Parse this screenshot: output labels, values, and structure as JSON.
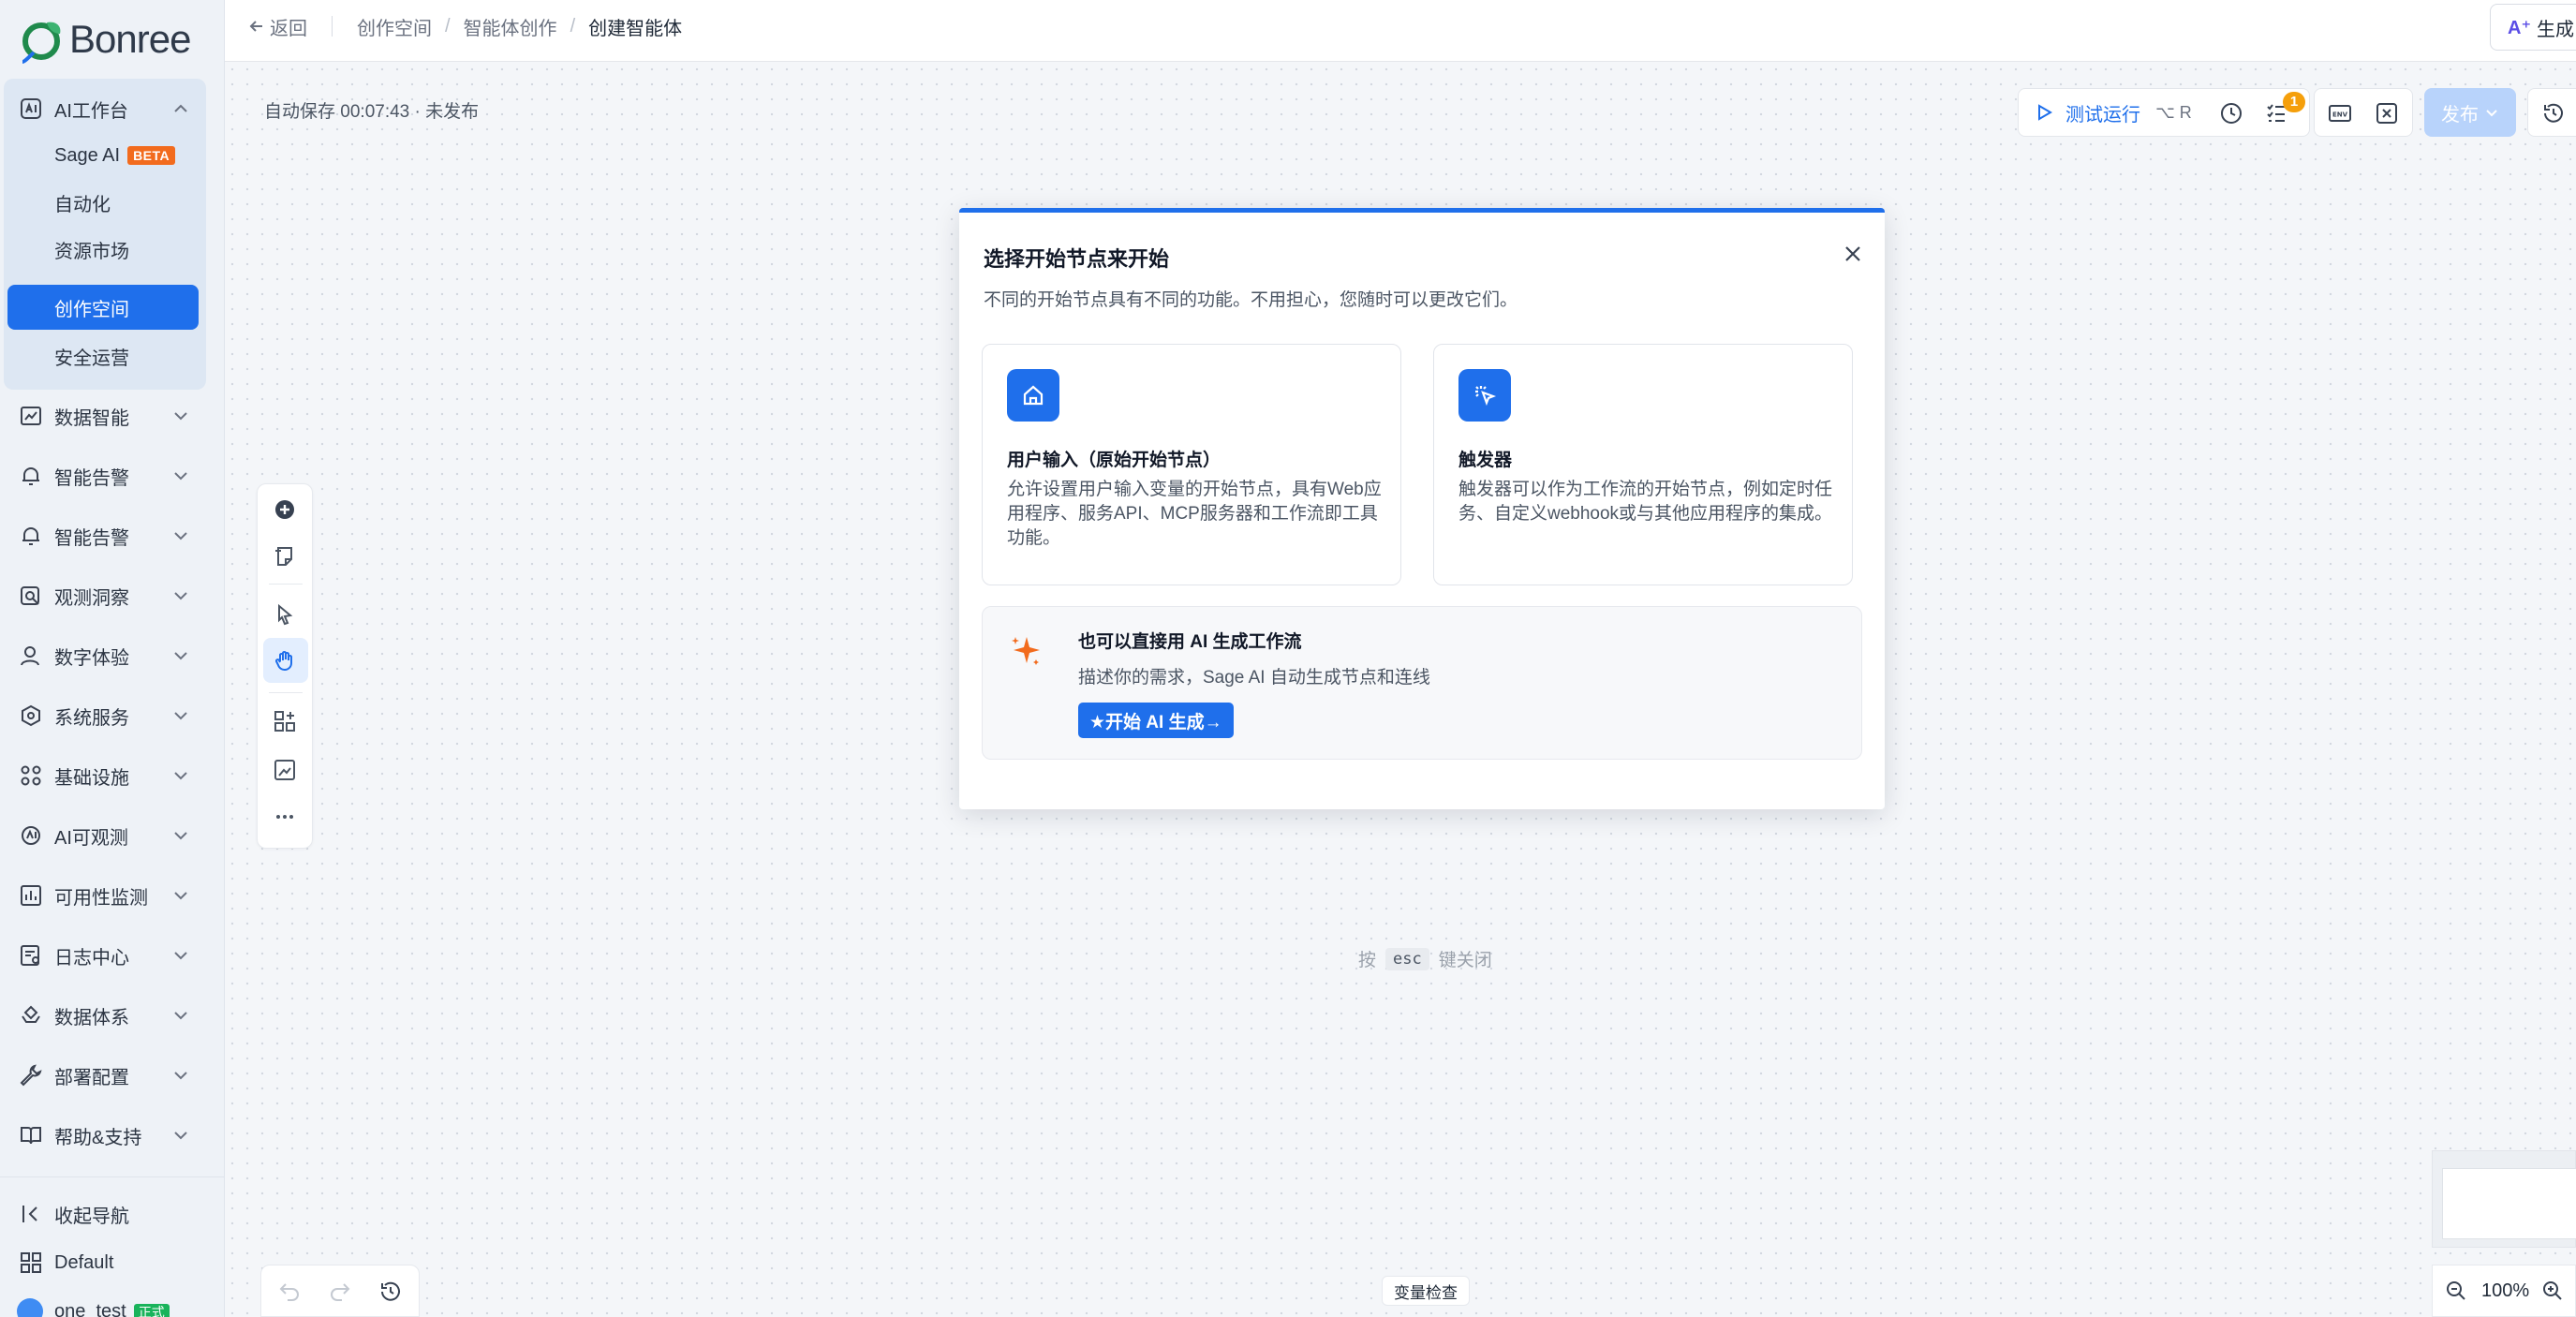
{
  "brand": {
    "name": "Bonree"
  },
  "colors": {
    "accent": "#1f6feb",
    "beta_badge": "#f26b1d",
    "env_badge": "#19b35b",
    "notif_badge": "#f59f0b",
    "ai_orange": "#f26b1d"
  },
  "sidebar": {
    "workbench": {
      "label": "AI工作台",
      "icon": "ai-workbench-icon",
      "children": [
        {
          "label": "Sage AI",
          "badge": "BETA"
        },
        {
          "label": "自动化"
        },
        {
          "label": "资源市场"
        },
        {
          "label": "创作空间",
          "active": true
        },
        {
          "label": "安全运营"
        }
      ]
    },
    "items": [
      {
        "label": "数据智能",
        "icon": "chart-icon"
      },
      {
        "label": "智能告警",
        "icon": "alert-icon"
      },
      {
        "label": "智能告警",
        "icon": "alert-icon"
      },
      {
        "label": "观测洞察",
        "icon": "search-icon"
      },
      {
        "label": "数字体验",
        "icon": "user-icon"
      },
      {
        "label": "系统服务",
        "icon": "service-icon"
      },
      {
        "label": "基础设施",
        "icon": "infra-icon"
      },
      {
        "label": "AI可观测",
        "icon": "ai-observe-icon"
      },
      {
        "label": "可用性监测",
        "icon": "monitor-icon"
      },
      {
        "label": "日志中心",
        "icon": "log-icon"
      },
      {
        "label": "数据体系",
        "icon": "data-system-icon"
      },
      {
        "label": "部署配置",
        "icon": "wrench-icon"
      },
      {
        "label": "帮助&支持",
        "icon": "book-icon"
      }
    ],
    "bottom": {
      "collapse_label": "收起导航",
      "workspace_label": "Default",
      "user_label": "one_test",
      "user_env_badge": "正式"
    }
  },
  "header": {
    "back_label": "返回",
    "breadcrumbs": [
      "创作空间",
      "智能体创作",
      "创建智能体"
    ],
    "generate_label": "生成",
    "generate_ai_mark": "A⁺"
  },
  "canvas": {
    "autosave_text": "自动保存 00:07:43 · 未发布",
    "toolbar": {
      "run_label": "测试运行",
      "run_shortcut": "⌥ R",
      "checklist_badge": "1",
      "env_label": "ENV",
      "publish_label": "发布"
    },
    "esc_hint": {
      "before": "按",
      "key": "esc",
      "after": "键关闭"
    },
    "variable_check_label": "变量检查",
    "zoom_label": "100%"
  },
  "modal": {
    "title": "选择开始节点来开始",
    "subtitle": "不同的开始节点具有不同的功能。不用担心，您随时可以更改它们。",
    "cards": [
      {
        "title": "用户输入（原始开始节点）",
        "desc": "允许设置用户输入变量的开始节点，具有Web应用程序、服务API、MCP服务器和工作流即工具功能。",
        "icon": "home-icon"
      },
      {
        "title": "触发器",
        "desc": "触发器可以作为工作流的开始节点，例如定时任务、自定义webhook或与其他应用程序的集成。",
        "icon": "cursor-click-icon"
      }
    ],
    "ai": {
      "title": "也可以直接用 AI 生成工作流",
      "desc": "描述你的需求，Sage AI 自动生成节点和连线",
      "button_label": "★开始 AI 生成→",
      "icon": "sparkle-icon"
    }
  }
}
